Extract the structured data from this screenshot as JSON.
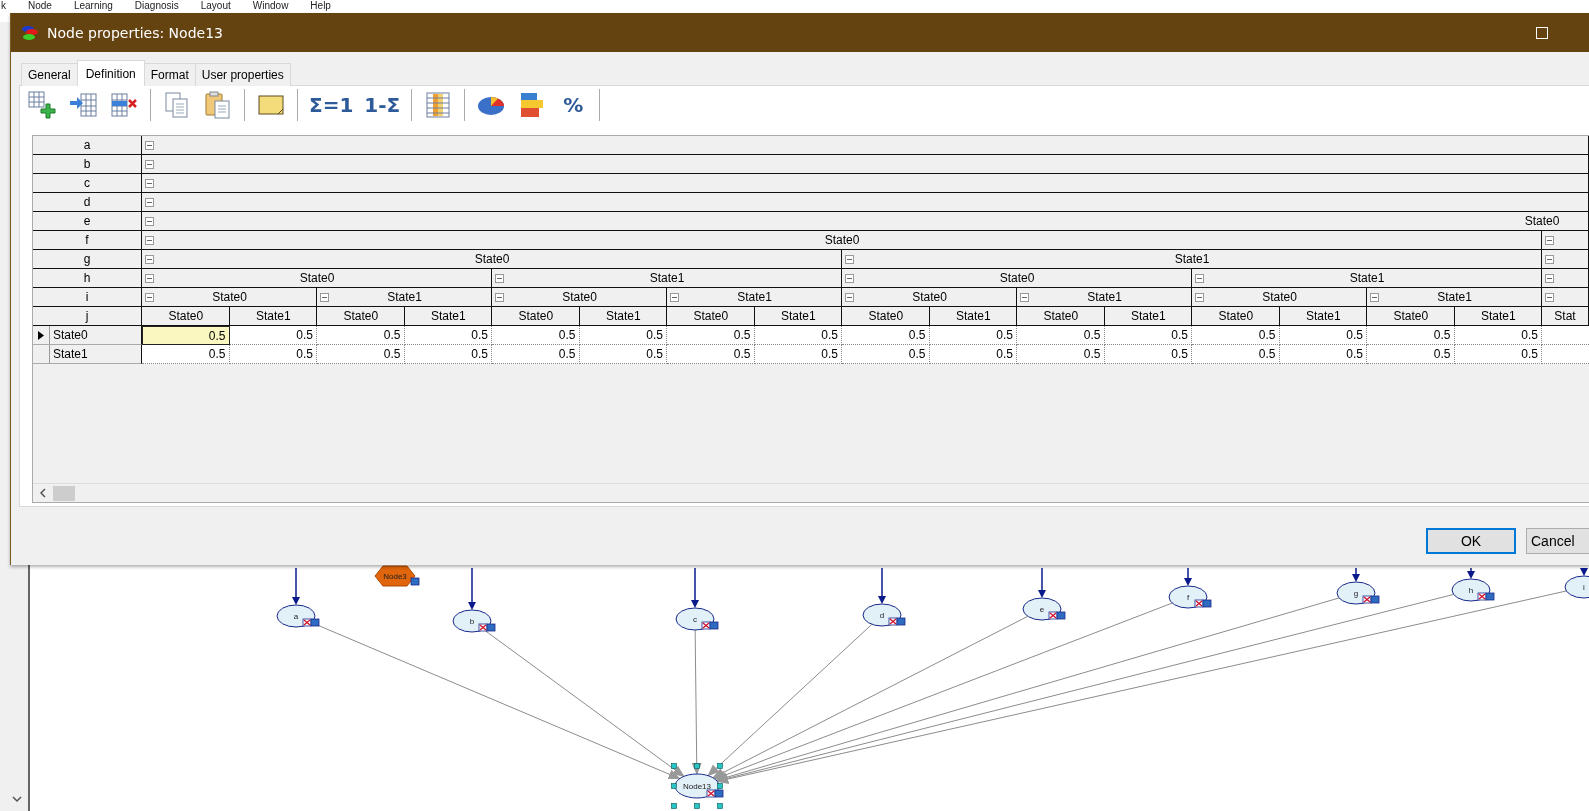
{
  "menu": [
    "k",
    "Node",
    "Learning",
    "Diagnosis",
    "Layout",
    "Window",
    "Help"
  ],
  "dialog": {
    "title": "Node properties: Node13",
    "tabs": [
      {
        "label": "General",
        "selected": false
      },
      {
        "label": "Definition",
        "selected": true
      },
      {
        "label": "Format",
        "selected": false
      },
      {
        "label": "User properties",
        "selected": false
      }
    ],
    "toolbar": [
      [
        {
          "kind": "addrow"
        },
        {
          "kind": "insert"
        },
        {
          "kind": "delete"
        }
      ],
      [
        {
          "kind": "copy"
        },
        {
          "kind": "paste"
        }
      ],
      [
        {
          "kind": "note"
        }
      ],
      [
        {
          "kind": "text",
          "label": "Σ=1"
        },
        {
          "kind": "text",
          "label": "1-Σ"
        }
      ],
      [
        {
          "kind": "columns"
        }
      ],
      [
        {
          "kind": "pie"
        },
        {
          "kind": "bars"
        },
        {
          "kind": "text",
          "label": "%"
        }
      ]
    ],
    "table": {
      "parents": [
        {
          "name": "a"
        },
        {
          "name": "b"
        },
        {
          "name": "c"
        },
        {
          "name": "d"
        },
        {
          "name": "e",
          "states": [
            "State0"
          ]
        },
        {
          "name": "f",
          "states": [
            "State0"
          ]
        },
        {
          "name": "g",
          "states": [
            "State0",
            "State1"
          ]
        },
        {
          "name": "h",
          "states": [
            "State0",
            "State1",
            "State0",
            "State1"
          ]
        },
        {
          "name": "i",
          "states": [
            "State0",
            "State1",
            "State0",
            "State1",
            "State0",
            "State1",
            "State0",
            "State1"
          ]
        },
        {
          "name": "j",
          "states": [
            "State0",
            "State1",
            "State0",
            "State1",
            "State0",
            "State1",
            "State0",
            "State1",
            "State0",
            "State1",
            "State0",
            "State1",
            "State0",
            "State1",
            "State0",
            "State1",
            "Stat"
          ]
        }
      ],
      "rows": [
        {
          "name": "State0",
          "current": true,
          "values": [
            {
              "value": "0.5",
              "selected": true
            },
            {
              "value": "0.5",
              "selected": false
            },
            {
              "value": "0.5",
              "selected": false
            },
            {
              "value": "0.5",
              "selected": false
            },
            {
              "value": "0.5",
              "selected": false
            },
            {
              "value": "0.5",
              "selected": false
            },
            {
              "value": "0.5",
              "selected": false
            },
            {
              "value": "0.5",
              "selected": false
            },
            {
              "value": "0.5",
              "selected": false
            },
            {
              "value": "0.5",
              "selected": false
            },
            {
              "value": "0.5",
              "selected": false
            },
            {
              "value": "0.5",
              "selected": false
            },
            {
              "value": "0.5",
              "selected": false
            },
            {
              "value": "0.5",
              "selected": false
            },
            {
              "value": "0.5",
              "selected": false
            },
            {
              "value": "0.5",
              "selected": false
            }
          ]
        },
        {
          "name": "State1",
          "current": false,
          "values": [
            {
              "value": "0.5",
              "selected": false
            },
            {
              "value": "0.5",
              "selected": false
            },
            {
              "value": "0.5",
              "selected": false
            },
            {
              "value": "0.5",
              "selected": false
            },
            {
              "value": "0.5",
              "selected": false
            },
            {
              "value": "0.5",
              "selected": false
            },
            {
              "value": "0.5",
              "selected": false
            },
            {
              "value": "0.5",
              "selected": false
            },
            {
              "value": "0.5",
              "selected": false
            },
            {
              "value": "0.5",
              "selected": false
            },
            {
              "value": "0.5",
              "selected": false
            },
            {
              "value": "0.5",
              "selected": false
            },
            {
              "value": "0.5",
              "selected": false
            },
            {
              "value": "0.5",
              "selected": false
            },
            {
              "value": "0.5",
              "selected": false
            },
            {
              "value": "0.5",
              "selected": false
            }
          ]
        }
      ]
    },
    "buttons": [
      {
        "label": "OK",
        "default": true
      },
      {
        "label": "Cancel",
        "default": false
      }
    ]
  },
  "canvas": {
    "nodes": [
      {
        "label": "a",
        "kind": "chance",
        "selected": false,
        "parent_above": true,
        "arc_to_node13": true
      },
      {
        "label": "Node3",
        "kind": "equation",
        "selected": false,
        "arc_to_node13": false
      },
      {
        "label": "b",
        "kind": "chance",
        "selected": false,
        "parent_above": true,
        "arc_to_node13": true
      },
      {
        "label": "c",
        "kind": "chance",
        "selected": false,
        "parent_above": true,
        "arc_to_node13": true
      },
      {
        "label": "d",
        "kind": "chance",
        "selected": false,
        "parent_above": true,
        "arc_to_node13": true
      },
      {
        "label": "e",
        "kind": "chance",
        "selected": false,
        "parent_above": true,
        "arc_to_node13": true
      },
      {
        "label": "f",
        "kind": "chance",
        "selected": false,
        "parent_above": true,
        "arc_to_node13": true
      },
      {
        "label": "g",
        "kind": "chance",
        "selected": false,
        "parent_above": true,
        "arc_to_node13": true
      },
      {
        "label": "h",
        "kind": "chance",
        "selected": false,
        "parent_above": true,
        "arc_to_node13": true
      },
      {
        "label": "i",
        "kind": "chance",
        "selected": false,
        "parent_above": true,
        "arc_to_node13": true
      },
      {
        "label": "Node13",
        "kind": "chance",
        "selected": true,
        "parent_above": false
      }
    ]
  }
}
